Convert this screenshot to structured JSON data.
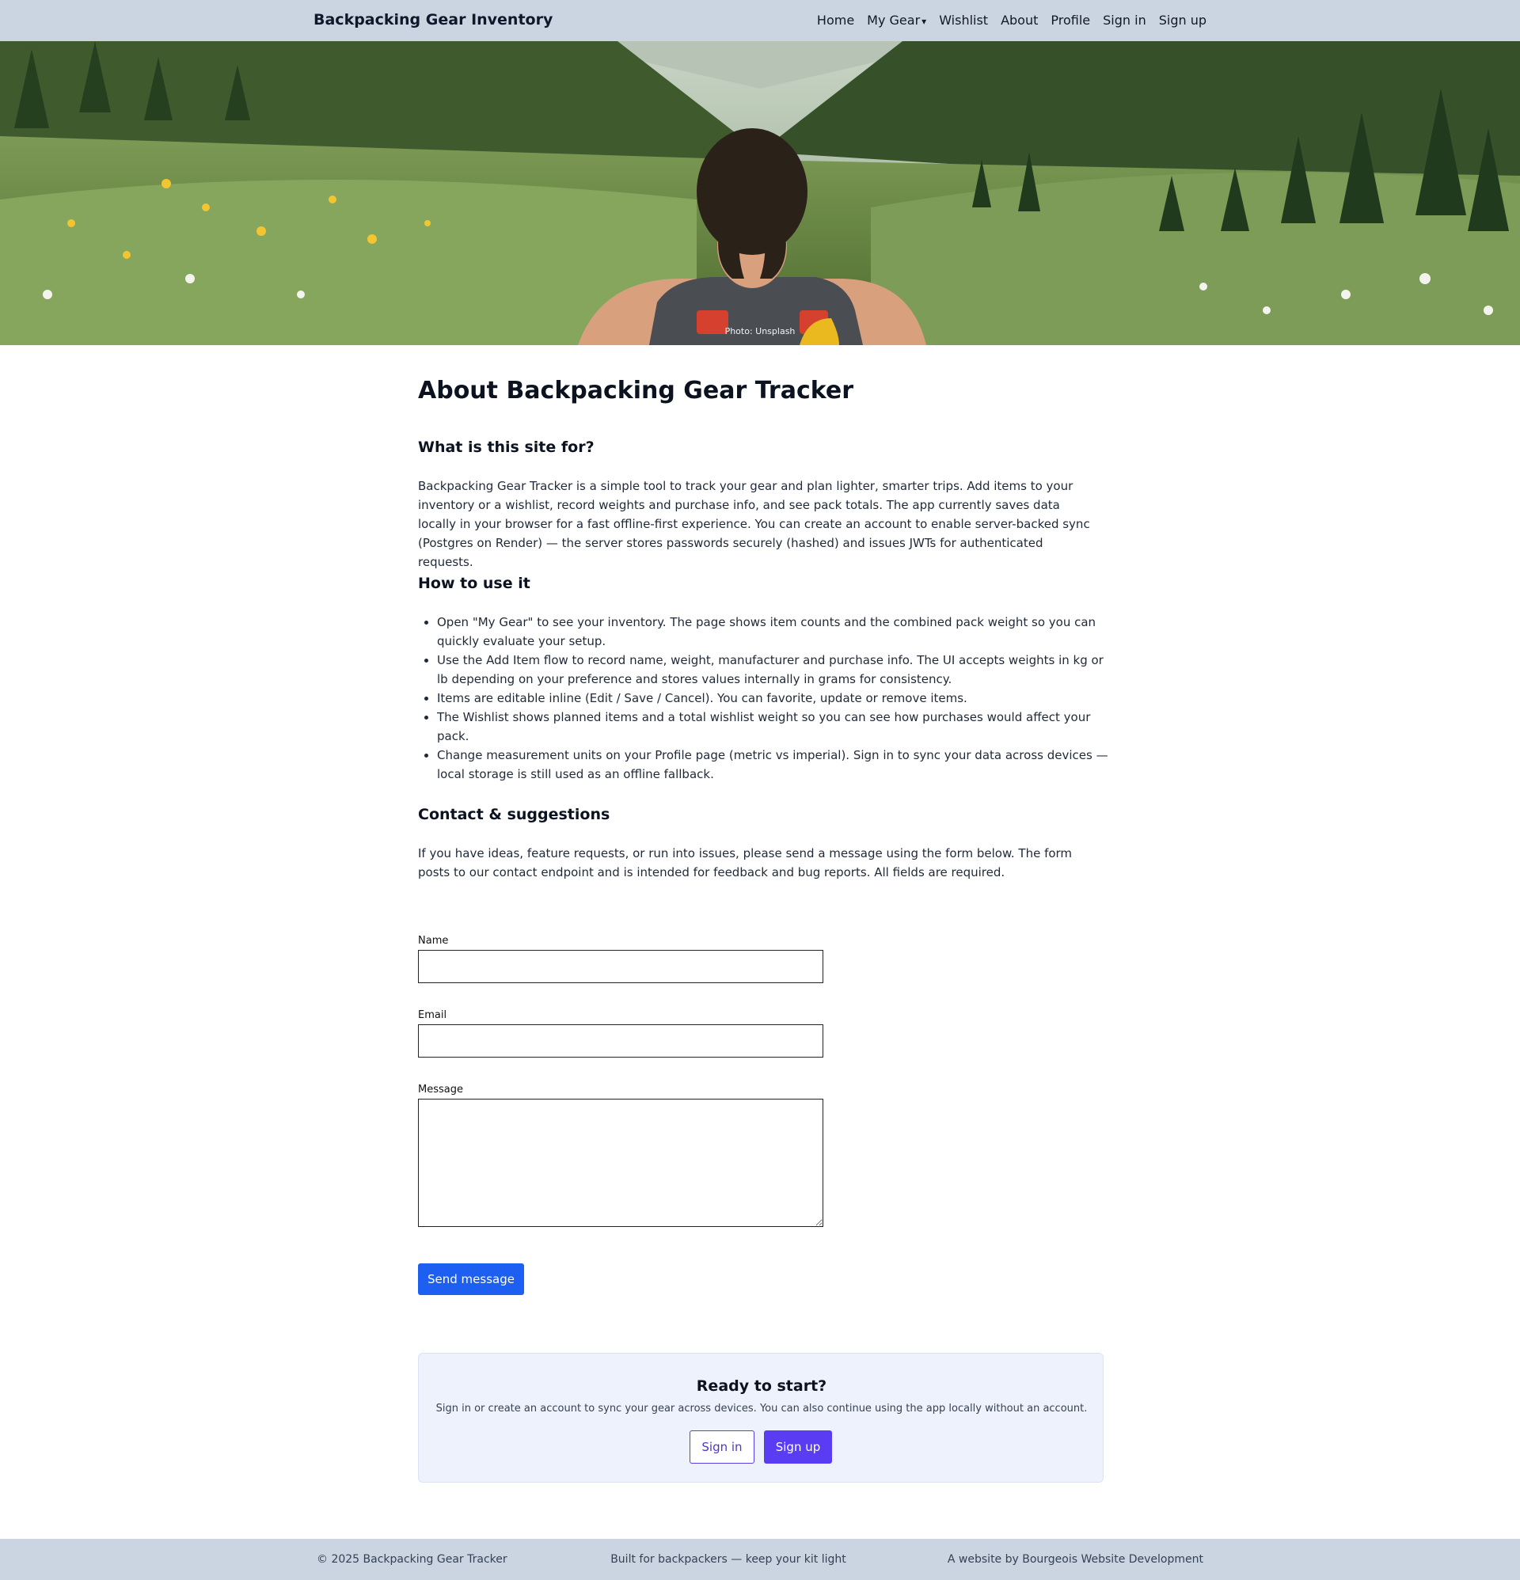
{
  "header": {
    "brand": "Backpacking Gear Inventory",
    "nav": [
      "Home",
      "My Gear",
      "Wishlist",
      "About",
      "Profile",
      "Sign in",
      "Sign up"
    ]
  },
  "hero": {
    "credit": "Photo: Unsplash"
  },
  "main": {
    "title": "About Backpacking Gear Tracker",
    "section_what": {
      "heading": "What is this site for?",
      "text": "Backpacking Gear Tracker is a simple tool to track your gear and plan lighter, smarter trips. Add items to your inventory or a wishlist, record weights and purchase info, and see pack totals. The app currently saves data locally in your browser for a fast offline-first experience. You can create an account to enable server-backed sync (Postgres on Render) — the server stores passwords securely (hashed) and issues JWTs for authenticated requests."
    },
    "section_how": {
      "heading": "How to use it",
      "items": [
        "Open \"My Gear\" to see your inventory. The page shows item counts and the combined pack weight so you can quickly evaluate your setup.",
        "Use the Add Item flow to record name, weight, manufacturer and purchase info. The UI accepts weights in kg or lb depending on your preference and stores values internally in grams for consistency.",
        "Items are editable inline (Edit / Save / Cancel). You can favorite, update or remove items.",
        "The Wishlist shows planned items and a total wishlist weight so you can see how purchases would affect your pack.",
        "Change measurement units on your Profile page (metric vs imperial). Sign in to sync your data across devices — local storage is still used as an offline fallback."
      ]
    },
    "section_contact": {
      "heading": "Contact & suggestions",
      "text": "If you have ideas, feature requests, or run into issues, please send a message using the form below. The form posts to our contact endpoint and is intended for feedback and bug reports. All fields are required."
    },
    "form": {
      "name_label": "Name",
      "name_value": "",
      "email_label": "Email",
      "email_value": "",
      "message_label": "Message",
      "message_value": "",
      "submit": "Send message"
    },
    "cta": {
      "title": "Ready to start?",
      "text": "Sign in or create an account to sync your gear across devices. You can also continue using the app locally without an account.",
      "signin": "Sign in",
      "signup": "Sign up"
    }
  },
  "footer": {
    "left": "© 2025 Backpacking Gear Tracker",
    "middle": "Built for backpackers — keep your kit light",
    "right": "A website by Bourgeois Website Development"
  },
  "colors": {
    "header_bg": "#cbd5e1",
    "primary_blue": "#1d5ff0",
    "accent_purple": "#5a3df2",
    "cta_bg": "#eef2fc"
  }
}
